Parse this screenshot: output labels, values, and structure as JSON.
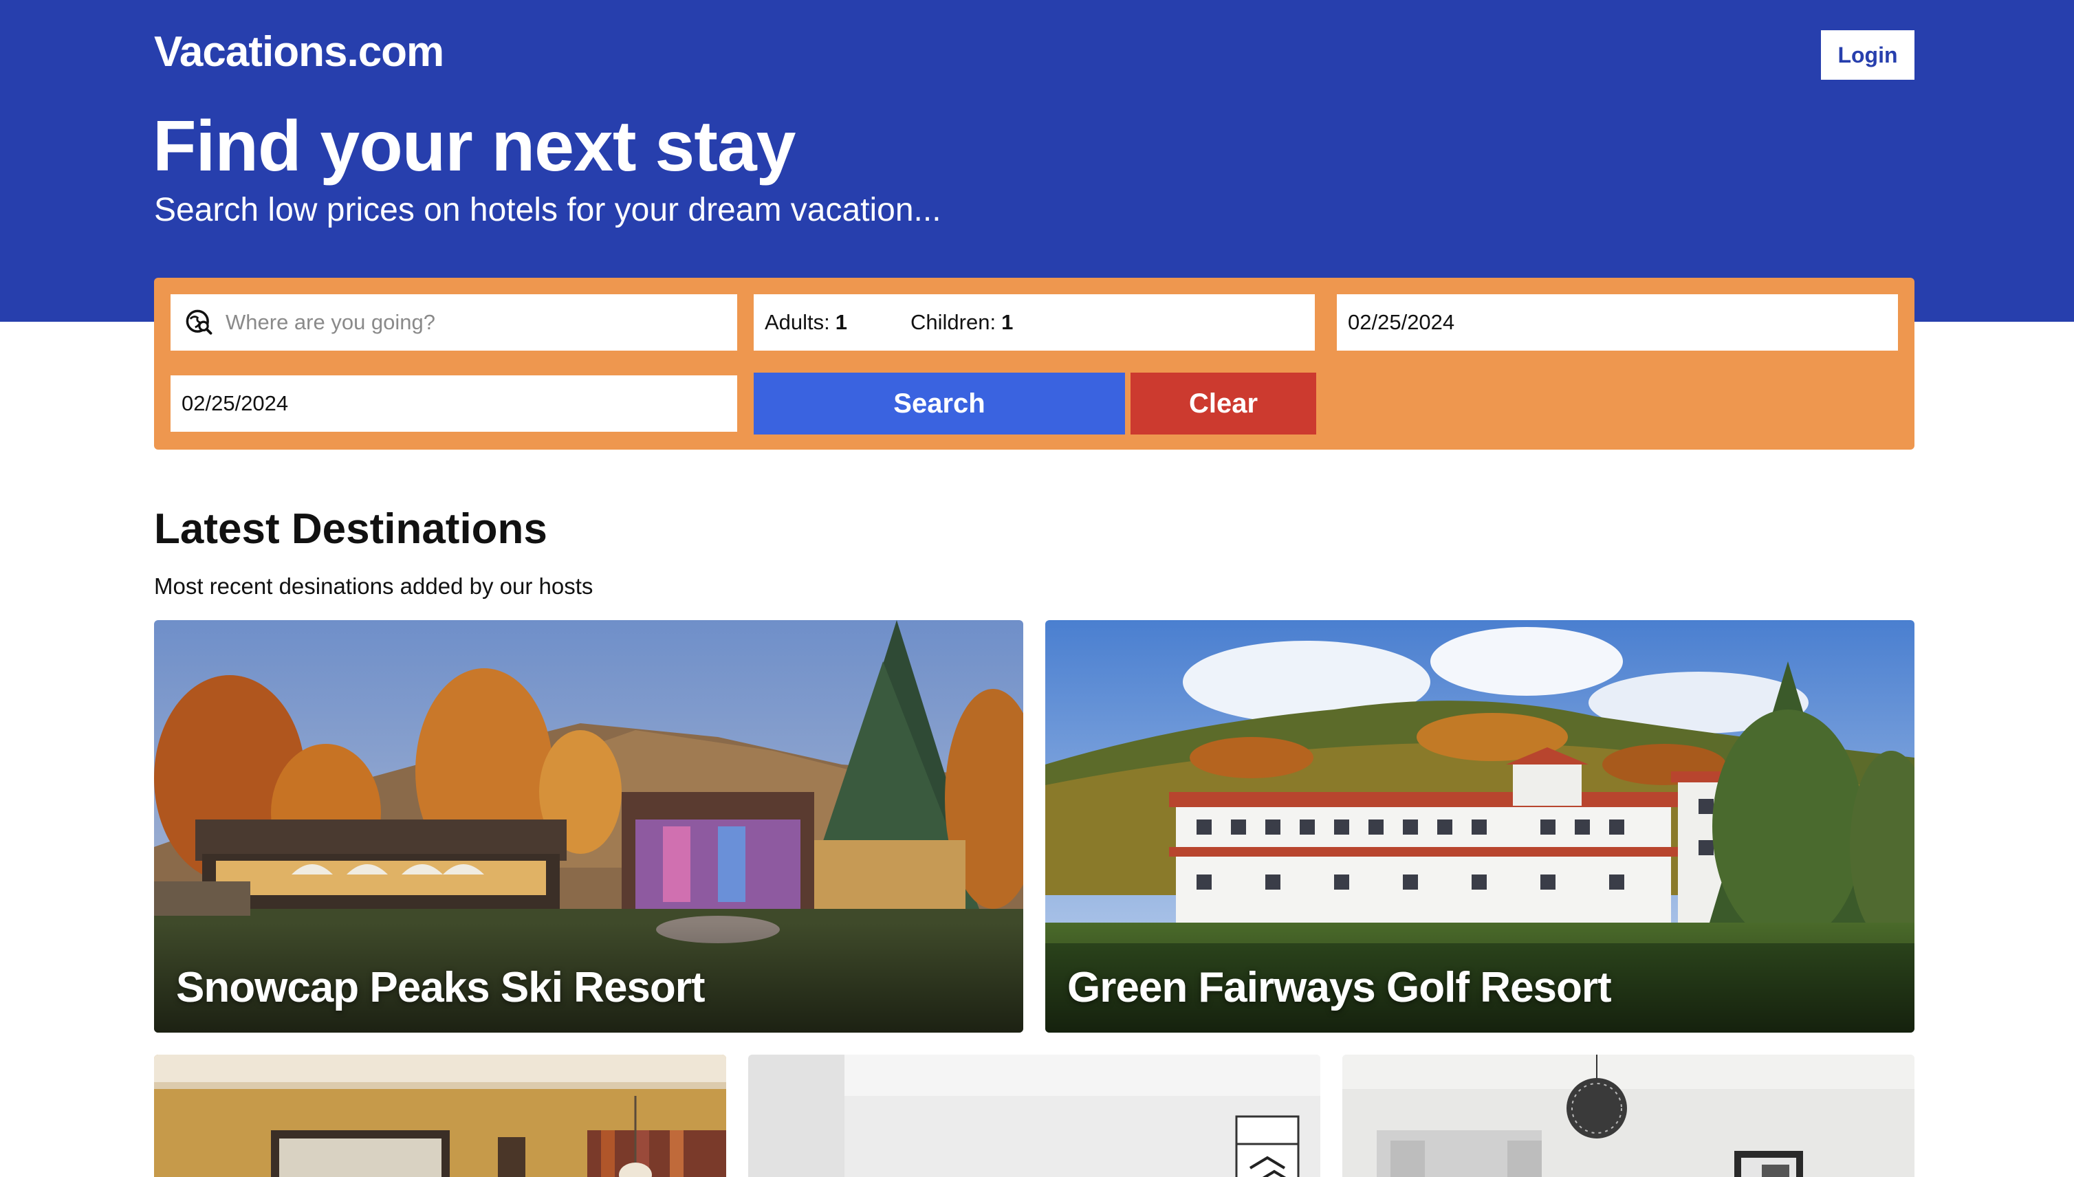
{
  "header": {
    "logo": "Vacations.com",
    "login_label": "Login"
  },
  "hero": {
    "title": "Find your next stay",
    "subtitle": "Search low prices on hotels for your dream vacation..."
  },
  "search": {
    "destination_placeholder": "Where are you going?",
    "destination_icon": "search-location-icon",
    "adults_label": "Adults:",
    "adults_value": "1",
    "children_label": "Children:",
    "children_value": "1",
    "check_in": "02/25/2024",
    "check_out": "02/25/2024",
    "search_label": "Search",
    "clear_label": "Clear"
  },
  "latest": {
    "title": "Latest Destinations",
    "subtitle": "Most recent desinations added by our hosts",
    "cards": [
      {
        "name": "Snowcap Peaks Ski Resort"
      },
      {
        "name": "Green Fairways Golf Resort"
      },
      {
        "name": ""
      },
      {
        "name": ""
      },
      {
        "name": ""
      }
    ]
  },
  "colors": {
    "brand_blue": "#273fad",
    "search_panel": "#ee974f",
    "search_button": "#3a63e0",
    "clear_button": "#cc3a2f"
  }
}
